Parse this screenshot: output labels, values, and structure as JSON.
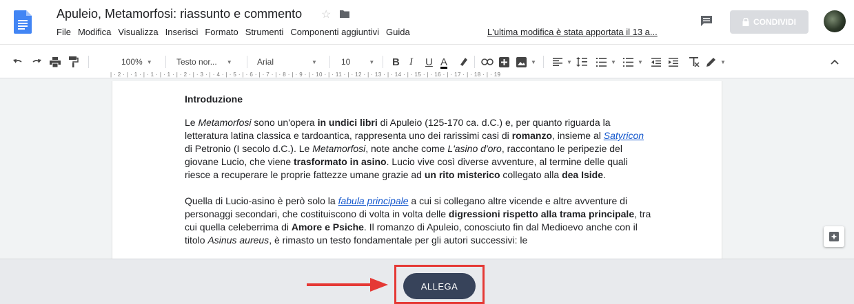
{
  "document": {
    "title": "Apuleio, Metamorfosi: riassunto e commento",
    "last_edit": "L'ultima modifica è stata apportata il 13 a..."
  },
  "menu": [
    "File",
    "Modifica",
    "Visualizza",
    "Inserisci",
    "Formato",
    "Strumenti",
    "Componenti aggiuntivi",
    "Guida"
  ],
  "share_label": "CONDIVIDI",
  "toolbar": {
    "zoom": "100%",
    "style": "Testo nor...",
    "font": "Arial",
    "font_size": "10",
    "bold": "B",
    "italic": "I",
    "underline": "U",
    "text_color": "A"
  },
  "ruler": "| · 2 · | · 1 · | · 1 · | · 1 · | · 2 · | · 3 · | · 4 · | · 5 · | · 6 · | · 7 · | · 8 · | · 9 · | · 10 · | · 11 · | · 12 · | · 13 · | · 14 · | · 15 · | · 16 · | · 17 · | · 18 · | · 19",
  "content": {
    "heading": "Introduzione",
    "p1": {
      "t1": "Le ",
      "t2": "Metamorfosi",
      "t3": " sono un'opera ",
      "t4": "in undici libri",
      "t5": " di Apuleio (125-170 ca. d.C.) e, per quanto riguarda la letteratura latina classica e tardoantica, rappresenta uno dei rarissimi casi di ",
      "t6": "romanzo",
      "t7": ", insieme al ",
      "t8": "Satyricon",
      "t9": " di Petronio (I secolo d.C.). Le ",
      "t10": "Metamorfosi",
      "t11": ", note anche come ",
      "t12": "L'asino d'oro",
      "t13": ", raccontano le peripezie del giovane Lucio, che viene ",
      "t14": "trasformato in asino",
      "t15": ". Lucio vive così diverse avventure, al termine delle quali riesce a recuperare le proprie fattezze umane grazie ad ",
      "t16": "un rito misterico",
      "t17": " collegato alla ",
      "t18": "dea Iside",
      "t19": "."
    },
    "p2": {
      "t1": "Quella di Lucio-asino è però solo la ",
      "t2": "fabula principale",
      "t3": " a cui si collegano altre vicende e altre avventure di personaggi secondari, che costituiscono di volta in volta delle ",
      "t4": "digressioni rispetto alla trama principale",
      "t5": ", tra cui quella celeberrima di ",
      "t6": "Amore e Psiche",
      "t7": ". Il romanzo di Apuleio, conosciuto fin dal Medioevo anche con il titolo ",
      "t8": "Asinus aureus",
      "t9": ", è rimasto un testo fondamentale per gli autori successivi: le"
    }
  },
  "attach_button": "ALLEGA",
  "colors": {
    "doc_blue": "#4285f4",
    "link": "#1155cc",
    "button_dark": "#37435a",
    "highlight_red": "#e53935"
  }
}
